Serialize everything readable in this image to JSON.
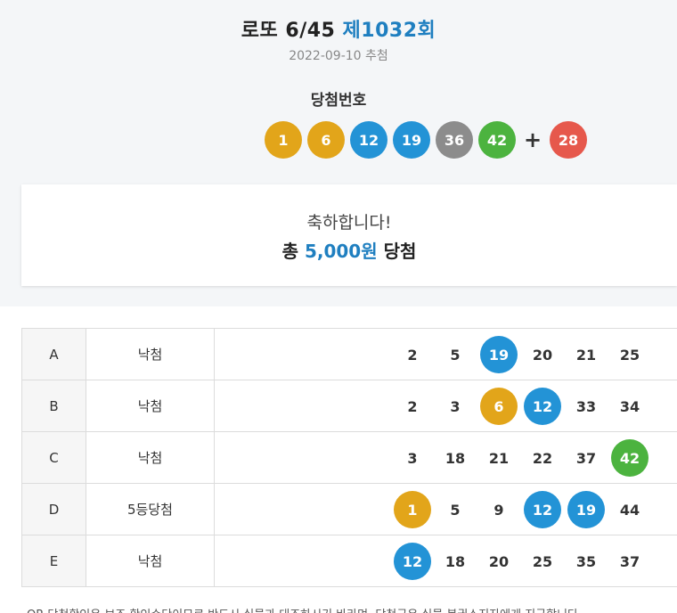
{
  "header": {
    "title_prefix": "로또 6/45",
    "round": "제1032회",
    "draw_date": "2022-09-10 추첨",
    "winning_label": "당첨번호"
  },
  "winning_numbers": [
    "1",
    "6",
    "12",
    "19",
    "36",
    "42"
  ],
  "plus_sign": "+",
  "bonus_number": "28",
  "summary": {
    "congrats": "축하합니다!",
    "total_prefix": "총",
    "amount": "5,000원",
    "total_suffix": "당첨"
  },
  "games": [
    {
      "label": "A",
      "result": "낙첨",
      "numbers": [
        "2",
        "5",
        "19",
        "20",
        "21",
        "25"
      ],
      "matched": [
        false,
        false,
        true,
        false,
        false,
        false
      ]
    },
    {
      "label": "B",
      "result": "낙첨",
      "numbers": [
        "2",
        "3",
        "6",
        "12",
        "33",
        "34"
      ],
      "matched": [
        false,
        false,
        true,
        true,
        false,
        false
      ]
    },
    {
      "label": "C",
      "result": "낙첨",
      "numbers": [
        "3",
        "18",
        "21",
        "22",
        "37",
        "42"
      ],
      "matched": [
        false,
        false,
        false,
        false,
        false,
        true
      ]
    },
    {
      "label": "D",
      "result": "5등당첨",
      "numbers": [
        "1",
        "5",
        "9",
        "12",
        "19",
        "44"
      ],
      "matched": [
        true,
        false,
        false,
        true,
        true,
        false
      ]
    },
    {
      "label": "E",
      "result": "낙첨",
      "numbers": [
        "12",
        "18",
        "20",
        "25",
        "35",
        "37"
      ],
      "matched": [
        true,
        false,
        false,
        false,
        false,
        false
      ]
    }
  ],
  "notice": "QR 당첨확인은 보조 확인수단이므로 반드시 실물과 대조하시기 바라며, 당첨금은 실물 복권소지자에게 지급합니다.",
  "colors": {
    "ball_yellow": "#e2a51a",
    "ball_blue": "#2393d6",
    "ball_gray": "#8c8c8c",
    "ball_green": "#4cb33f",
    "ball_red": "#e6584c",
    "accent": "#1f7fc0"
  }
}
